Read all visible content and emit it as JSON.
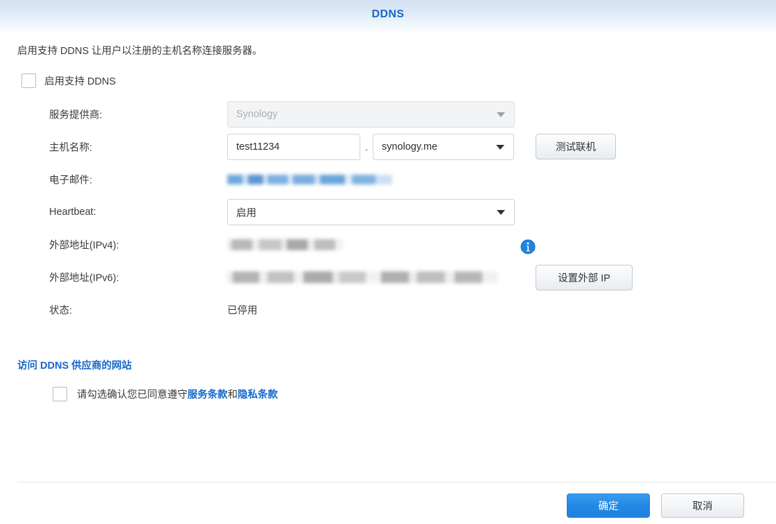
{
  "dialog": {
    "title": "DDNS",
    "description": "启用支持 DDNS 让用户以注册的主机名称连接服务器。"
  },
  "enable": {
    "label": "启用支持 DDNS",
    "checked": false
  },
  "fields": {
    "provider": {
      "label": "服务提供商:",
      "value": "Synology",
      "disabled": true
    },
    "hostname": {
      "label": "主机名称:",
      "value": "test11234",
      "separator": ".",
      "domain": "synology.me"
    },
    "email": {
      "label": "电子邮件:",
      "value": ""
    },
    "heartbeat": {
      "label": "Heartbeat:",
      "value": "启用"
    },
    "external_ipv4": {
      "label": "外部地址(IPv4):",
      "value": ""
    },
    "external_ipv6": {
      "label": "外部地址(IPv6):",
      "value": ""
    },
    "status": {
      "label": "状态:",
      "value": "已停用"
    }
  },
  "buttons": {
    "test_connection": "测试联机",
    "set_external_ip": "设置外部 IP",
    "ok": "确定",
    "cancel": "取消"
  },
  "links": {
    "visit_provider": "访问 DDNS 供应商的网站"
  },
  "terms": {
    "prefix": "请勾选确认您已同意遵守",
    "terms_of_service": "服务条款",
    "conjunction": "和",
    "privacy_policy": "隐私条款",
    "checked": false
  },
  "colors": {
    "accent": "#1668c8",
    "primary_button": "#2388e4",
    "title_gradient_top": "#d2e0f1",
    "text": "#3a3a3a",
    "disabled_text": "#aaaeb2"
  }
}
